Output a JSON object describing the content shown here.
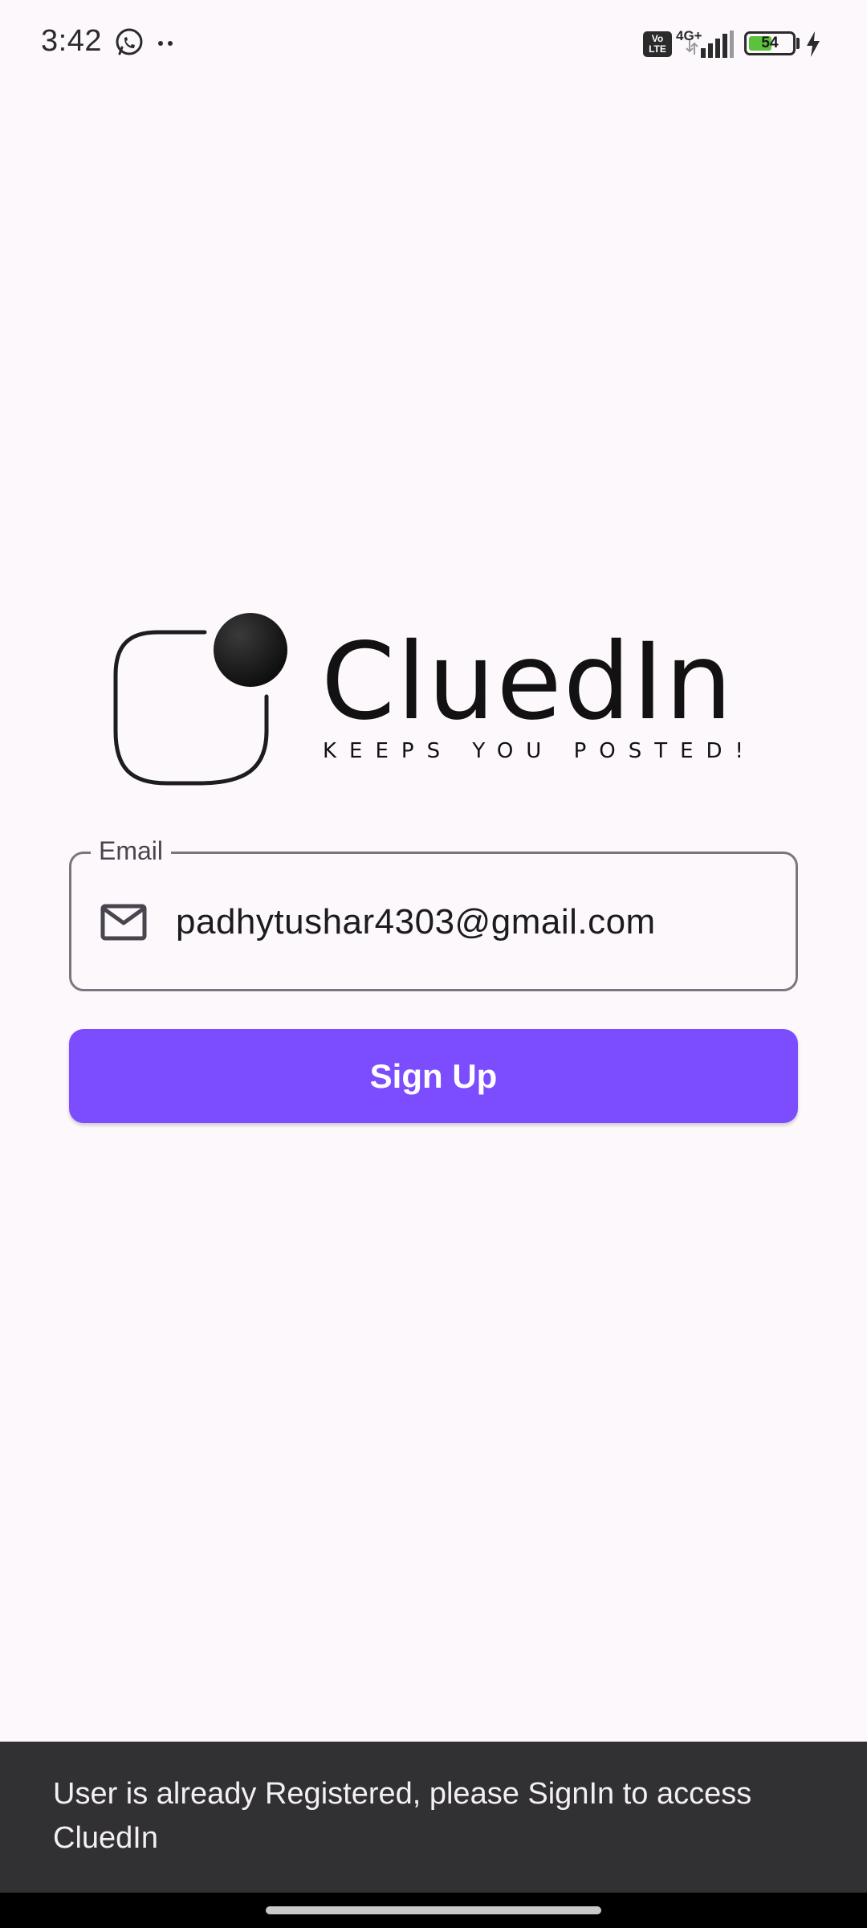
{
  "status_bar": {
    "time": "3:42",
    "network": "4G+",
    "volte_badge": "Vo LTE",
    "battery_level": "54",
    "battery_fraction": 0.54,
    "icons": [
      "whatsapp-icon",
      "more-notifications-icon",
      "volte-icon",
      "signal-icon",
      "battery-icon",
      "charging-icon"
    ]
  },
  "logo": {
    "name": "CluedIn",
    "tagline": "KEEPS YOU POSTED!"
  },
  "email_field": {
    "label": "Email",
    "value": "padhytushar4303@gmail.com",
    "icon": "mail-icon"
  },
  "signup_button": {
    "label": "Sign Up",
    "color": "#7c4dff"
  },
  "snackbar": {
    "message": "User is already Registered, please SignIn to access CluedIn"
  }
}
